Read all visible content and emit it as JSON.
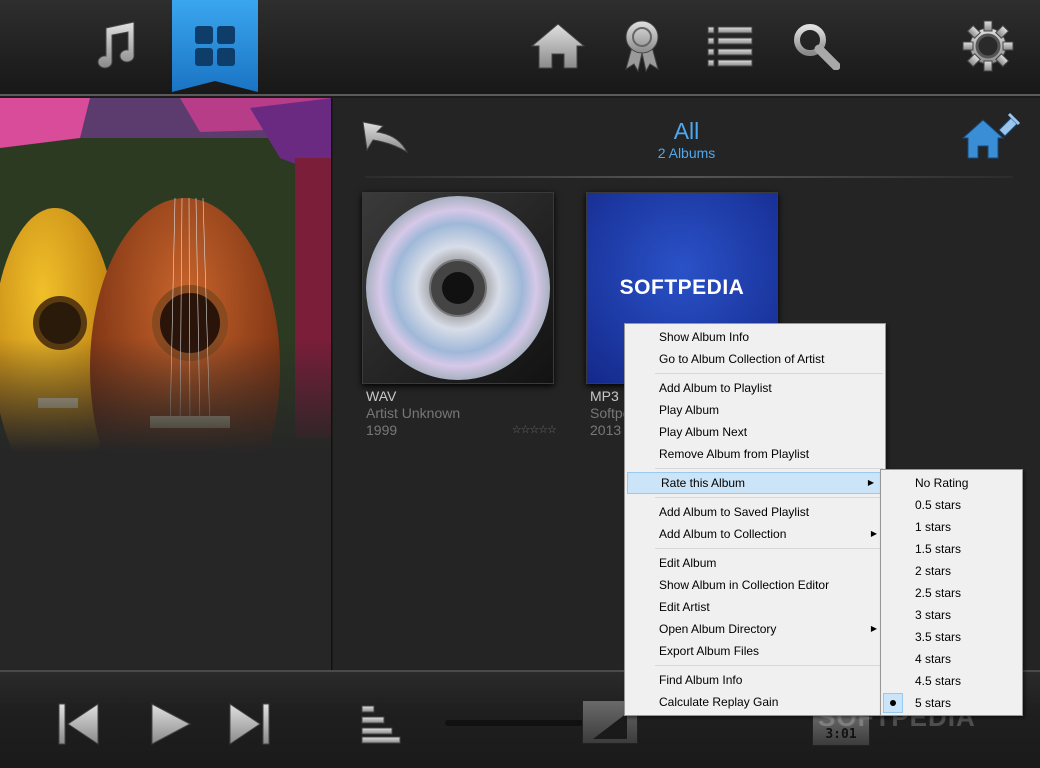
{
  "header": {
    "view_title": "All",
    "view_subtitle": "2 Albums"
  },
  "albums": [
    {
      "format": "WAV",
      "artist": "Artist Unknown",
      "year": "1999",
      "rating_stars": "☆☆☆☆☆",
      "cover": "cd-disc"
    },
    {
      "format": "MP3",
      "artist": "Softpe",
      "year": "2013",
      "cover_text": "SOFTPEDIA",
      "cover_color": "#1d3ea8"
    }
  ],
  "context_menu": {
    "items": [
      {
        "label": "Show Album Info"
      },
      {
        "label": "Go to Album Collection of Artist"
      },
      {
        "separator": true
      },
      {
        "label": "Add Album to Playlist"
      },
      {
        "label": "Play Album"
      },
      {
        "label": "Play Album Next"
      },
      {
        "label": "Remove Album from Playlist"
      },
      {
        "separator": true
      },
      {
        "label": "Rate this Album",
        "submenu": true,
        "highlighted": true
      },
      {
        "separator": true
      },
      {
        "label": "Add Album to Saved Playlist"
      },
      {
        "label": "Add Album to Collection",
        "submenu": true
      },
      {
        "separator": true
      },
      {
        "label": "Edit Album"
      },
      {
        "label": "Show Album in Collection Editor"
      },
      {
        "label": "Edit Artist"
      },
      {
        "label": "Open Album Directory",
        "submenu": true
      },
      {
        "label": "Export Album Files"
      },
      {
        "separator": true
      },
      {
        "label": "Find Album Info"
      },
      {
        "label": "Calculate Replay Gain"
      }
    ]
  },
  "rating_menu": {
    "items": [
      {
        "label": "No Rating"
      },
      {
        "label": "0.5 stars"
      },
      {
        "label": "1 stars"
      },
      {
        "label": "1.5 stars"
      },
      {
        "label": "2 stars"
      },
      {
        "label": "2.5 stars"
      },
      {
        "label": "3 stars"
      },
      {
        "label": "3.5 stars"
      },
      {
        "label": "4 stars"
      },
      {
        "label": "4.5 stars"
      },
      {
        "label": "5 stars",
        "selected": true
      }
    ]
  },
  "player": {
    "time": "3:01"
  },
  "watermark": "SOFTPEDIA",
  "icons": {
    "top_nav": [
      "music-note-icon",
      "albums-grid-icon",
      "home-icon",
      "award-icon",
      "list-icon",
      "search-icon",
      "gear-icon"
    ],
    "content": [
      "back-arrow-icon",
      "home-pin-icon"
    ],
    "bottom": [
      "previous-icon",
      "play-icon",
      "next-icon",
      "playlist-icon"
    ]
  },
  "colors": {
    "accent": "#4ea8ef",
    "nav_active": "#2a8de0",
    "menu_highlight": "#cce4f7"
  }
}
